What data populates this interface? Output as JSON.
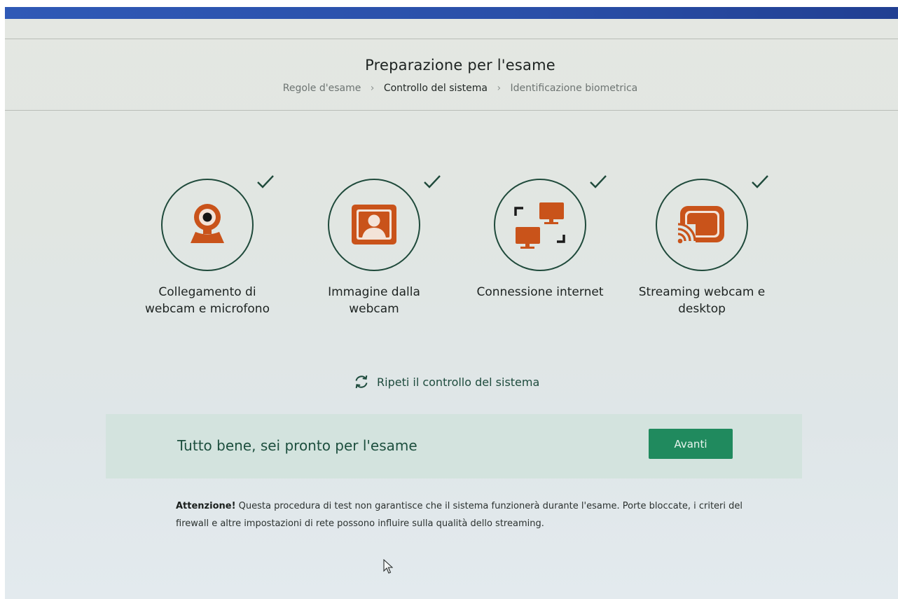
{
  "header": {
    "title": "Preparazione per l'esame",
    "breadcrumb": [
      {
        "label": "Regole d'esame",
        "active": false
      },
      {
        "label": "Controllo del sistema",
        "active": true
      },
      {
        "label": "Identificazione biometrica",
        "active": false
      }
    ]
  },
  "checks": [
    {
      "label_line1": "Collegamento di",
      "label_line2": "webcam e microfono",
      "icon": "webcam-icon",
      "status": "passed"
    },
    {
      "label_line1": "Immagine dalla",
      "label_line2": "webcam",
      "icon": "portrait-icon",
      "status": "passed"
    },
    {
      "label_line1": "Connessione internet",
      "label_line2": "",
      "icon": "network-computers-icon",
      "status": "passed"
    },
    {
      "label_line1": "Streaming webcam e",
      "label_line2": "desktop",
      "icon": "cast-icon",
      "status": "passed"
    }
  ],
  "retry": {
    "label": "Ripeti il controllo del sistema",
    "icon": "refresh-icon"
  },
  "status": {
    "message": "Tutto bene, sei pronto per l'esame",
    "next_label": "Avanti"
  },
  "notice": {
    "bold": "Attenzione!",
    "text": " Questa procedura di test non garantisce che il sistema funzionerà durante l'esame. Porte bloccate, i criteri del firewall e altre impostazioni di rete possono influire sulla qualità dello streaming."
  },
  "colors": {
    "accent_green": "#1f4a3b",
    "button_green": "#208a5e",
    "icon_orange": "#c9531a",
    "panel_bg": "#d3e3de",
    "top_bar_blue": "#2f59b6"
  }
}
